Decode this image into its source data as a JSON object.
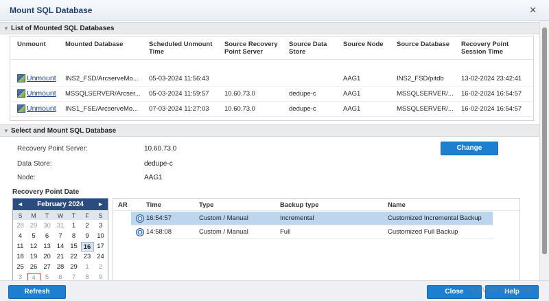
{
  "window": {
    "title": "Mount SQL Database"
  },
  "mounted_section": {
    "title": "List of Mounted SQL Databases",
    "columns": [
      "Unmount",
      "Mounted Database",
      "Scheduled Unmount Time",
      "Source Recovery Point Server",
      "Source Data Store",
      "Source Node",
      "Source Database",
      "Recovery Point Session Time"
    ],
    "rows": [
      {
        "action": "Unmount",
        "mounted_db": "INS2_FSD/ArcserveMo...",
        "scheduled": "05-03-2024 11:56:43",
        "rps": "",
        "store": "",
        "node": "AAG1",
        "source_db": "INS2_FSD/pitdb",
        "session": "13-02-2024 23:42:41"
      },
      {
        "action": "Unmount",
        "mounted_db": "MSSQLSERVER/Arcser...",
        "scheduled": "05-03-2024 11:59:57",
        "rps": "10.60.73.0",
        "store": "dedupe-c",
        "node": "AAG1",
        "source_db": "MSSQLSERVER/...",
        "session": "16-02-2024 16:54:57"
      },
      {
        "action": "Unmount",
        "mounted_db": "INS1_FSE/ArcserveMo...",
        "scheduled": "07-03-2024 11:27:03",
        "rps": "10.60.73.0",
        "store": "dedupe-c",
        "node": "AAG1",
        "source_db": "MSSQLSERVER/...",
        "session": "16-02-2024 16:54:57"
      }
    ]
  },
  "select_section": {
    "title": "Select and Mount SQL Database",
    "rps_label": "Recovery Point Server:",
    "rps_value": "10.60.73.0",
    "store_label": "Data Store:",
    "store_value": "dedupe-c",
    "node_label": "Node:",
    "node_value": "AAG1",
    "change_label": "Change",
    "rp_date_label": "Recovery Point Date"
  },
  "calendar": {
    "month": "February 2024",
    "prev_icon": "◄",
    "next_icon": "►",
    "dow": [
      "S",
      "M",
      "T",
      "W",
      "T",
      "F",
      "S"
    ],
    "days": [
      [
        "28",
        "29",
        "30",
        "31",
        "1",
        "2",
        "3"
      ],
      [
        "4",
        "5",
        "6",
        "7",
        "8",
        "9",
        "10"
      ],
      [
        "11",
        "12",
        "13",
        "14",
        "15",
        "16",
        "17"
      ],
      [
        "18",
        "19",
        "20",
        "21",
        "22",
        "23",
        "24"
      ],
      [
        "25",
        "26",
        "27",
        "28",
        "29",
        "1",
        "2"
      ],
      [
        "3",
        "4",
        "5",
        "6",
        "7",
        "8",
        "9"
      ]
    ],
    "selected_day": "16",
    "today_label": "4"
  },
  "recovery_points": {
    "columns": [
      "AR",
      "Time",
      "Type",
      "Backup type",
      "Name"
    ],
    "rows": [
      {
        "time": "16:54:57",
        "type": "Custom / Manual",
        "backup_type": "Incremental",
        "name": "Customized Incremental Backup",
        "selected": true
      },
      {
        "time": "14:58:08",
        "type": "Custom / Manual",
        "backup_type": "Full",
        "name": "Customized Full Backup",
        "selected": false
      }
    ]
  },
  "footer": {
    "refresh_label": "Refresh",
    "close_label": "Close",
    "help_label": "Help"
  },
  "watermark": "Activate Windows",
  "colors": {
    "accent": "#1d7fd1",
    "calendar_header": "#2a4c7e",
    "selected_row": "#bcd6ee"
  }
}
